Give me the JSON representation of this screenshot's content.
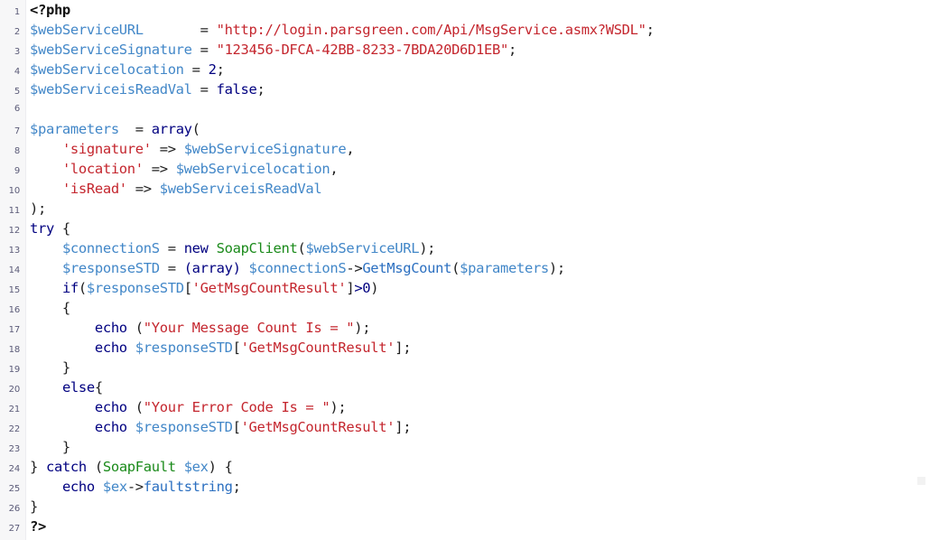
{
  "viewer": {
    "language": "php",
    "name": "php-source-snippet",
    "total_lines": 27,
    "first_line_number": 1,
    "gutter_visible": true,
    "theme": {
      "background": "#ffffff",
      "gutter_background": "#f7f7f8",
      "gutter_border": "#ededf0",
      "line_number": "#5b5b78",
      "default_text": "#202020",
      "tag": "#111111",
      "variable": "#4287c8",
      "keyword": "#000080",
      "string": "#c4262e",
      "class_name": "#1a8a1a",
      "function": "#2b6fc0",
      "number": "#000080"
    }
  },
  "code": {
    "lines": [
      {
        "n": "1",
        "text": "<?php",
        "tokens": [
          {
            "t": "tag",
            "v": "<?php"
          }
        ]
      },
      {
        "n": "2",
        "text": "$webServiceURL       = \"http://login.parsgreen.com/Api/MsgService.asmx?WSDL\";",
        "tokens": [
          {
            "t": "var",
            "v": "$webServiceURL"
          },
          {
            "t": "punct",
            "v": "       = "
          },
          {
            "t": "str",
            "v": "\"http://login.parsgreen.com/Api/MsgService.asmx?WSDL\""
          },
          {
            "t": "punct",
            "v": ";"
          }
        ]
      },
      {
        "n": "3",
        "text": "$webServiceSignature = \"123456-DFCA-42BB-8233-7BDA20D6D1EB\";",
        "tokens": [
          {
            "t": "var",
            "v": "$webServiceSignature"
          },
          {
            "t": "punct",
            "v": " = "
          },
          {
            "t": "str",
            "v": "\"123456-DFCA-42BB-8233-7BDA20D6D1EB\""
          },
          {
            "t": "punct",
            "v": ";"
          }
        ]
      },
      {
        "n": "4",
        "text": "$webServicelocation = 2;",
        "tokens": [
          {
            "t": "var",
            "v": "$webServicelocation"
          },
          {
            "t": "punct",
            "v": " = "
          },
          {
            "t": "num",
            "v": "2"
          },
          {
            "t": "punct",
            "v": ";"
          }
        ]
      },
      {
        "n": "5",
        "text": "$webServiceisReadVal = false;",
        "tokens": [
          {
            "t": "var",
            "v": "$webServiceisReadVal"
          },
          {
            "t": "punct",
            "v": " = "
          },
          {
            "t": "kw",
            "v": "false"
          },
          {
            "t": "punct",
            "v": ";"
          }
        ]
      },
      {
        "n": "6",
        "text": "",
        "tokens": []
      },
      {
        "n": "7",
        "text": "$parameters  = array(",
        "tokens": [
          {
            "t": "var",
            "v": "$parameters"
          },
          {
            "t": "punct",
            "v": "  = "
          },
          {
            "t": "kw",
            "v": "array"
          },
          {
            "t": "punct",
            "v": "("
          }
        ]
      },
      {
        "n": "8",
        "text": "    'signature' => $webServiceSignature,",
        "tokens": [
          {
            "t": "punct",
            "v": "    "
          },
          {
            "t": "str",
            "v": "'signature'"
          },
          {
            "t": "punct",
            "v": " => "
          },
          {
            "t": "var",
            "v": "$webServiceSignature"
          },
          {
            "t": "punct",
            "v": ","
          }
        ]
      },
      {
        "n": "9",
        "text": "    'location' => $webServicelocation,",
        "tokens": [
          {
            "t": "punct",
            "v": "    "
          },
          {
            "t": "str",
            "v": "'location'"
          },
          {
            "t": "punct",
            "v": " => "
          },
          {
            "t": "var",
            "v": "$webServicelocation"
          },
          {
            "t": "punct",
            "v": ","
          }
        ]
      },
      {
        "n": "10",
        "text": "    'isRead' => $webServiceisReadVal",
        "tokens": [
          {
            "t": "punct",
            "v": "    "
          },
          {
            "t": "str",
            "v": "'isRead'"
          },
          {
            "t": "punct",
            "v": " => "
          },
          {
            "t": "var",
            "v": "$webServiceisReadVal"
          }
        ]
      },
      {
        "n": "11",
        "text": ");",
        "tokens": [
          {
            "t": "punct",
            "v": ");"
          }
        ]
      },
      {
        "n": "12",
        "text": "try {",
        "tokens": [
          {
            "t": "kw",
            "v": "try"
          },
          {
            "t": "punct",
            "v": " {"
          }
        ]
      },
      {
        "n": "13",
        "text": "    $connectionS = new SoapClient($webServiceURL);",
        "tokens": [
          {
            "t": "punct",
            "v": "    "
          },
          {
            "t": "var",
            "v": "$connectionS"
          },
          {
            "t": "punct",
            "v": " = "
          },
          {
            "t": "kw",
            "v": "new"
          },
          {
            "t": "punct",
            "v": " "
          },
          {
            "t": "cls",
            "v": "SoapClient"
          },
          {
            "t": "punct",
            "v": "("
          },
          {
            "t": "var",
            "v": "$webServiceURL"
          },
          {
            "t": "punct",
            "v": ");"
          }
        ]
      },
      {
        "n": "14",
        "text": "    $responseSTD = (array) $connectionS->GetMsgCount($parameters);",
        "tokens": [
          {
            "t": "punct",
            "v": "    "
          },
          {
            "t": "var",
            "v": "$responseSTD"
          },
          {
            "t": "punct",
            "v": " = "
          },
          {
            "t": "kw",
            "v": "(array)"
          },
          {
            "t": "punct",
            "v": " "
          },
          {
            "t": "var",
            "v": "$connectionS"
          },
          {
            "t": "punct",
            "v": "->"
          },
          {
            "t": "fn",
            "v": "GetMsgCount"
          },
          {
            "t": "punct",
            "v": "("
          },
          {
            "t": "var",
            "v": "$parameters"
          },
          {
            "t": "punct",
            "v": ");"
          }
        ]
      },
      {
        "n": "15",
        "text": "    if($responseSTD['GetMsgCountResult']>0)",
        "tokens": [
          {
            "t": "punct",
            "v": "    "
          },
          {
            "t": "kw",
            "v": "if"
          },
          {
            "t": "punct",
            "v": "("
          },
          {
            "t": "var",
            "v": "$responseSTD"
          },
          {
            "t": "punct",
            "v": "["
          },
          {
            "t": "str",
            "v": "'GetMsgCountResult'"
          },
          {
            "t": "punct",
            "v": "]"
          },
          {
            "t": "kw",
            "v": ">0"
          },
          {
            "t": "punct",
            "v": ")"
          }
        ]
      },
      {
        "n": "16",
        "text": "    {",
        "tokens": [
          {
            "t": "punct",
            "v": "    {"
          }
        ]
      },
      {
        "n": "17",
        "text": "        echo (\"Your Message Count Is = \");",
        "tokens": [
          {
            "t": "punct",
            "v": "        "
          },
          {
            "t": "kw",
            "v": "echo"
          },
          {
            "t": "punct",
            "v": " ("
          },
          {
            "t": "str",
            "v": "\"Your Message Count Is = \""
          },
          {
            "t": "punct",
            "v": ");"
          }
        ]
      },
      {
        "n": "18",
        "text": "        echo $responseSTD['GetMsgCountResult'];",
        "tokens": [
          {
            "t": "punct",
            "v": "        "
          },
          {
            "t": "kw",
            "v": "echo"
          },
          {
            "t": "punct",
            "v": " "
          },
          {
            "t": "var",
            "v": "$responseSTD"
          },
          {
            "t": "punct",
            "v": "["
          },
          {
            "t": "str",
            "v": "'GetMsgCountResult'"
          },
          {
            "t": "punct",
            "v": "];"
          }
        ]
      },
      {
        "n": "19",
        "text": "    }",
        "tokens": [
          {
            "t": "punct",
            "v": "    }"
          }
        ]
      },
      {
        "n": "20",
        "text": "    else{",
        "tokens": [
          {
            "t": "punct",
            "v": "    "
          },
          {
            "t": "kw",
            "v": "else"
          },
          {
            "t": "punct",
            "v": "{"
          }
        ]
      },
      {
        "n": "21",
        "text": "        echo (\"Your Error Code Is = \");",
        "tokens": [
          {
            "t": "punct",
            "v": "        "
          },
          {
            "t": "kw",
            "v": "echo"
          },
          {
            "t": "punct",
            "v": " ("
          },
          {
            "t": "str",
            "v": "\"Your Error Code Is = \""
          },
          {
            "t": "punct",
            "v": ");"
          }
        ]
      },
      {
        "n": "22",
        "text": "        echo $responseSTD['GetMsgCountResult'];",
        "tokens": [
          {
            "t": "punct",
            "v": "        "
          },
          {
            "t": "kw",
            "v": "echo"
          },
          {
            "t": "punct",
            "v": " "
          },
          {
            "t": "var",
            "v": "$responseSTD"
          },
          {
            "t": "punct",
            "v": "["
          },
          {
            "t": "str",
            "v": "'GetMsgCountResult'"
          },
          {
            "t": "punct",
            "v": "];"
          }
        ]
      },
      {
        "n": "23",
        "text": "    }",
        "tokens": [
          {
            "t": "punct",
            "v": "    }"
          }
        ]
      },
      {
        "n": "24",
        "text": "} catch (SoapFault $ex) {",
        "tokens": [
          {
            "t": "punct",
            "v": "} "
          },
          {
            "t": "kw",
            "v": "catch"
          },
          {
            "t": "punct",
            "v": " ("
          },
          {
            "t": "cls",
            "v": "SoapFault"
          },
          {
            "t": "punct",
            "v": " "
          },
          {
            "t": "var",
            "v": "$ex"
          },
          {
            "t": "punct",
            "v": ") {"
          }
        ]
      },
      {
        "n": "25",
        "text": "    echo $ex->faultstring;",
        "tokens": [
          {
            "t": "punct",
            "v": "    "
          },
          {
            "t": "kw",
            "v": "echo"
          },
          {
            "t": "punct",
            "v": " "
          },
          {
            "t": "var",
            "v": "$ex"
          },
          {
            "t": "punct",
            "v": "->"
          },
          {
            "t": "fn",
            "v": "faultstring"
          },
          {
            "t": "punct",
            "v": ";"
          }
        ]
      },
      {
        "n": "26",
        "text": "}",
        "tokens": [
          {
            "t": "punct",
            "v": "}"
          }
        ]
      },
      {
        "n": "27",
        "text": "?>",
        "tokens": [
          {
            "t": "tag",
            "v": "?>"
          }
        ]
      }
    ]
  }
}
